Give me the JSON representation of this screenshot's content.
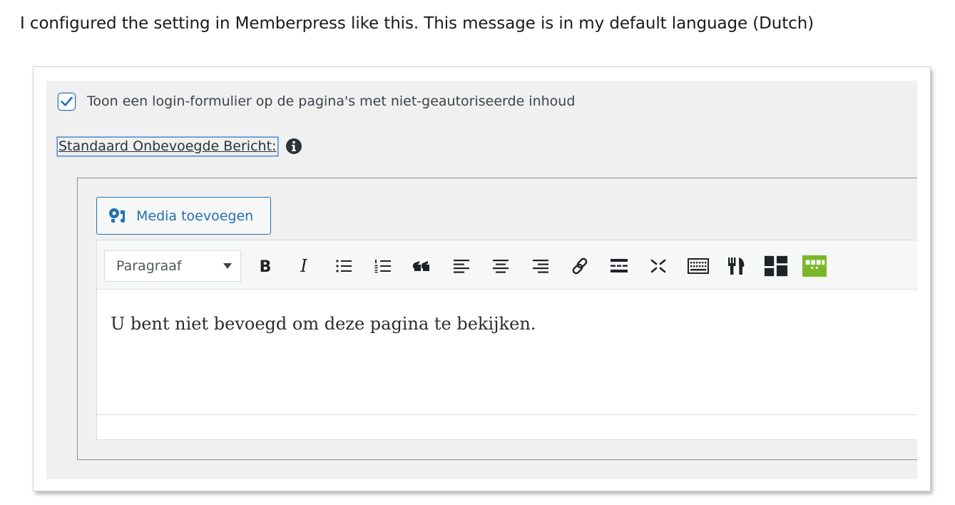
{
  "caption": "I configured the setting in Memberpress like this. This message is in my default language (Dutch)",
  "settings": {
    "login_form_checkbox": {
      "label": "Toon een login-formulier op de pagina's met niet-geautoriseerde inhoud",
      "checked": true
    },
    "unauthorized_message_label": "Standaard Onbevoegde Bericht:",
    "info_icon": "info-circle-icon"
  },
  "editor": {
    "media_button": {
      "label": "Media toevoegen",
      "icon": "add-media-icon"
    },
    "format_select": {
      "value": "Paragraaf"
    },
    "toolbar_buttons": [
      {
        "name": "bold",
        "icon": "bold-icon"
      },
      {
        "name": "italic",
        "icon": "italic-icon"
      },
      {
        "name": "bulleted-list",
        "icon": "bulleted-list-icon"
      },
      {
        "name": "numbered-list",
        "icon": "numbered-list-icon"
      },
      {
        "name": "blockquote",
        "icon": "blockquote-icon"
      },
      {
        "name": "align-left",
        "icon": "align-left-icon"
      },
      {
        "name": "align-center",
        "icon": "align-center-icon"
      },
      {
        "name": "align-right",
        "icon": "align-right-icon"
      },
      {
        "name": "insert-link",
        "icon": "link-icon"
      },
      {
        "name": "read-more",
        "icon": "read-more-icon"
      },
      {
        "name": "fullscreen",
        "icon": "fullscreen-icon"
      },
      {
        "name": "toolbar-toggle",
        "icon": "keyboard-icon"
      },
      {
        "name": "recipe",
        "icon": "fork-knife-icon"
      },
      {
        "name": "blocks",
        "icon": "blocks-grid-icon"
      },
      {
        "name": "table",
        "icon": "table-grid-icon"
      }
    ],
    "content": "U bent niet bevoegd om deze pagina te bekijken."
  },
  "colors": {
    "accent": "#2271b1",
    "panel_bg": "#f0f0f1",
    "table_icon_green": "#7ab829"
  }
}
